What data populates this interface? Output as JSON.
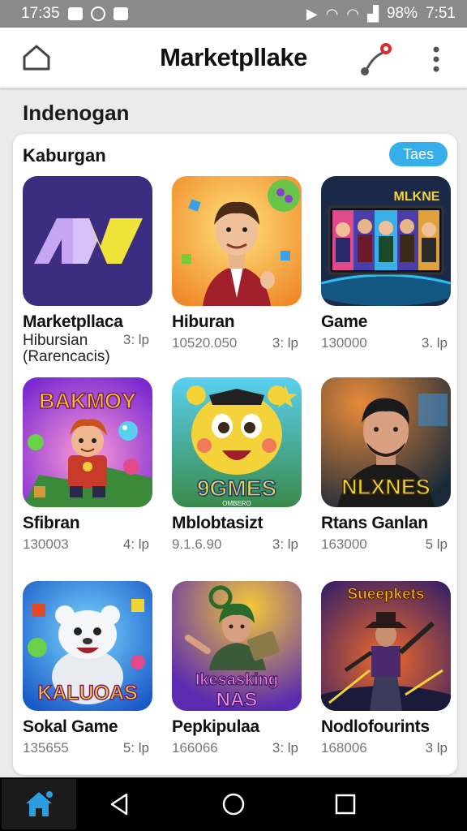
{
  "status": {
    "time_left": "17:35",
    "battery": "98%",
    "time_right": "7:51"
  },
  "header": {
    "title": "Marketpllake"
  },
  "section": {
    "title": "Indenogan"
  },
  "card": {
    "title": "Kaburgan",
    "badge": "Taes",
    "apps": [
      {
        "name": "Marketpllaca",
        "sub1": "Hibursian",
        "sub2": "(Rarencacis)",
        "count": "",
        "rating": "3: lp"
      },
      {
        "name": "Hiburan",
        "sub1": "",
        "sub2": "",
        "count": "10520.050",
        "rating": "3: lp"
      },
      {
        "name": "Game",
        "sub1": "",
        "sub2": "",
        "count": "130000",
        "rating": "3. lp"
      },
      {
        "name": "Sfibran",
        "sub1": "",
        "sub2": "",
        "count": "130003",
        "rating": "4: lp",
        "art_text": "BAKMOY"
      },
      {
        "name": "Mblobtasizt",
        "sub1": "",
        "sub2": "",
        "count": "9.1.6.90",
        "rating": "3: lp",
        "art_text": "9GMES",
        "art_sub": "OMBERO"
      },
      {
        "name": "Rtans Ganlan",
        "sub1": "",
        "sub2": "",
        "count": "163000",
        "rating": "5 lp",
        "art_text": "NLXNES"
      },
      {
        "name": "Sokal Game",
        "sub1": "",
        "sub2": "",
        "count": "135655",
        "rating": "5: lp",
        "art_text": "KALUOAS"
      },
      {
        "name": "Pepkipulaa",
        "sub1": "",
        "sub2": "",
        "count": "166066",
        "rating": "3: lp",
        "art_text": "Ikesasking",
        "art_sub": "NAS"
      },
      {
        "name": "Nodlofourints",
        "sub1": "",
        "sub2": "",
        "count": "168006",
        "rating": "3 lp",
        "art_text": "Sueepkets"
      }
    ],
    "tv_text": "MLKNE"
  },
  "colors": {
    "accent": "#36aee9",
    "nav_home": "#2a9ee0"
  }
}
